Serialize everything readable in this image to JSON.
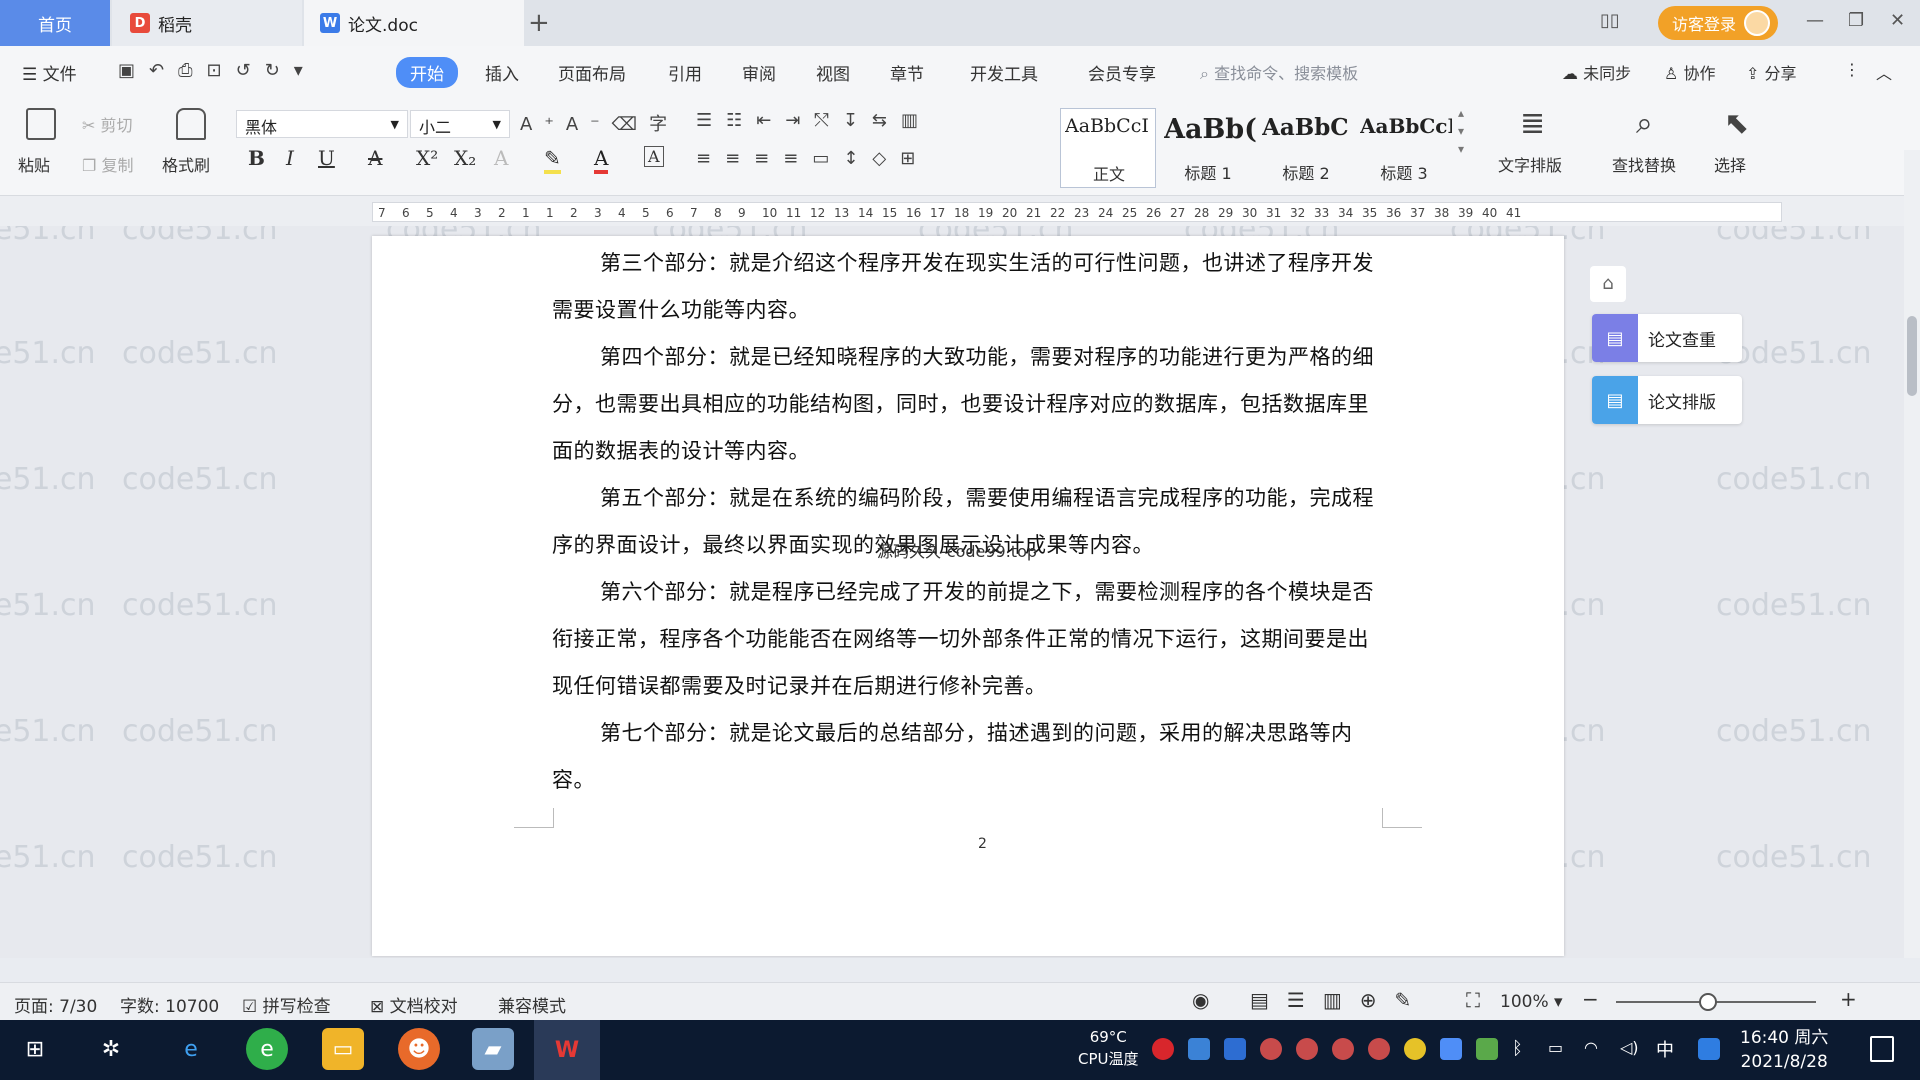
{
  "titlebar": {
    "tab_home": "首页",
    "tab_daoke": "稻壳",
    "tab_doc": "论文.doc",
    "login_label": "访客登录"
  },
  "ribbon": {
    "file_menu": "文件",
    "menus": [
      "开始",
      "插入",
      "页面布局",
      "引用",
      "审阅",
      "视图",
      "章节",
      "开发工具",
      "会员专享"
    ],
    "command_search_placeholder": "查找命令、搜索模板",
    "unsynced": "未同步",
    "collaborate": "协作",
    "share": "分享",
    "paste": "粘贴",
    "cut": "剪切",
    "copy": "复制",
    "format_painter": "格式刷",
    "font_name": "黑体",
    "font_size": "小二",
    "styles": [
      {
        "sample": "AaBbCcI",
        "name": "正文"
      },
      {
        "sample": "AaBb(",
        "name": "标题 1"
      },
      {
        "sample": "AaBbC",
        "name": "标题 2"
      },
      {
        "sample": "AaBbCcI",
        "name": "标题 3"
      }
    ],
    "text_layout": "文字排版",
    "find_replace": "查找替换",
    "select": "选择"
  },
  "ruler": {
    "ticks": [
      "7",
      "6",
      "5",
      "4",
      "3",
      "2",
      "1",
      "1",
      "2",
      "3",
      "4",
      "5",
      "6",
      "7",
      "8",
      "9",
      "10",
      "11",
      "12",
      "13",
      "14",
      "15",
      "16",
      "17",
      "18",
      "19",
      "20",
      "21",
      "22",
      "23",
      "24",
      "25",
      "26",
      "27",
      "28",
      "29",
      "30",
      "31",
      "32",
      "33",
      "34",
      "35",
      "36",
      "37",
      "38",
      "39",
      "40",
      "41"
    ]
  },
  "document": {
    "paragraphs": [
      {
        "indent": false,
        "text": ""
      },
      {
        "indent": true,
        "text": "第三个部分：就是介绍这个程序开发在现实生活的可行性问题，也讲述了程序开发需要设置什么功能等内容。"
      },
      {
        "indent": true,
        "text": "第四个部分：就是已经知晓程序的大致功能，需要对程序的功能进行更为严格的细分，也需要出具相应的功能结构图，同时，也要设计程序对应的数据库，包括数据库里面的数据表的设计等内容。"
      },
      {
        "indent": true,
        "text": "第五个部分：就是在系统的编码阶段，需要使用编程语言完成程序的功能，完成程序的界面设计，最终以界面实现的效果图展示设计成果等内容。"
      },
      {
        "indent": true,
        "text": "第六个部分：就是程序已经完成了开发的前提之下，需要检测程序的各个模块是否衔接正常，程序各个功能能否在网络等一切外部条件正常的情况下运行，这期间要是出现任何错误都需要及时记录并在后期进行修补完善。"
      },
      {
        "indent": true,
        "text": "第七个部分：就是论文最后的总结部分，描述遇到的问题，采用的解决思路等内容。"
      }
    ],
    "overlay_text": "源码久久-code99.top",
    "page_number": "2",
    "watermark": "code51.cn"
  },
  "side_panel": {
    "plagiarism_check": "论文查重",
    "paper_layout": "论文排版"
  },
  "statusbar": {
    "page": "页面: 7/30",
    "word_count": "字数: 10700",
    "spell_check": "拼写检查",
    "doc_proof": "文档校对",
    "compat_mode": "兼容模式",
    "zoom": "100%",
    "zoom_level_percent": 100
  },
  "taskbar": {
    "cpu_temp": "69°C",
    "cpu_label": "CPU温度",
    "ime": "中",
    "time": "16:40 周六",
    "date": "2021/8/28"
  },
  "colors": {
    "accent": "#4f8ef7",
    "login": "#f2a127",
    "taskbar": "#0c1a30",
    "side_check": "#7b7fe6",
    "side_layout": "#4aa3e8"
  }
}
